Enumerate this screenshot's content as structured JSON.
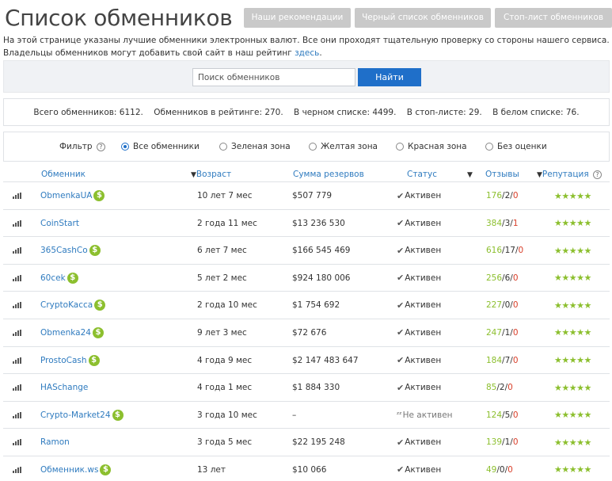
{
  "header": {
    "title": "Список обменников",
    "buttons": [
      "Наши рекомендации",
      "Черный список обменников",
      "Стоп-лист обменников"
    ]
  },
  "intro": {
    "line1": "На этой странице указаны лучшие обменники электронных валют. Все они проходят тщательную проверку со стороны нашего сервиса.",
    "line2": "Владельцы обменников могут добавить свой сайт в наш рейтинг ",
    "link": "здесь",
    "end": "."
  },
  "search": {
    "placeholder": "Поиск обменников",
    "button": "Найти"
  },
  "stats": {
    "total": "Всего обменников: 6112.",
    "rated": "Обменников в рейтинге: 270.",
    "black": "В черном списке: 4499.",
    "stop": "В стоп-листе: 29.",
    "white": "В белом списке: 76."
  },
  "filter": {
    "label": "Фильтр",
    "help": "?",
    "options": [
      "Все обменники",
      "Зеленая зона",
      "Желтая зона",
      "Красная зона",
      "Без оценки"
    ],
    "selected": "Все обменники"
  },
  "table": {
    "headers": {
      "name": "Обменник",
      "age": "Возраст",
      "reserve": "Сумма резервов",
      "status": "Статус",
      "reviews": "Отзывы",
      "reputation": "Репутация"
    },
    "rows": [
      {
        "name": "ObmenkaUA",
        "dollar": "$",
        "age": "10 лет 7 мес",
        "reserve": "$507 779",
        "status": "Активен",
        "active": true,
        "pos": "176",
        "neu": "2",
        "neg": "0",
        "stars": "★★★★★"
      },
      {
        "name": "CoinStart",
        "dollar": "",
        "age": "2 года 11 мес",
        "reserve": "$13 236 530",
        "status": "Активен",
        "active": true,
        "pos": "384",
        "neu": "3",
        "neg": "1",
        "stars": "★★★★★"
      },
      {
        "name": "365CashCo",
        "dollar": "$",
        "age": "6 лет 7 мес",
        "reserve": "$166 545 469",
        "status": "Активен",
        "active": true,
        "pos": "616",
        "neu": "17",
        "neg": "0",
        "stars": "★★★★★"
      },
      {
        "name": "60cek",
        "dollar": "$",
        "age": "5 лет 2 мес",
        "reserve": "$924 180 006",
        "status": "Активен",
        "active": true,
        "pos": "256",
        "neu": "6",
        "neg": "0",
        "stars": "★★★★★"
      },
      {
        "name": "CryptoKacca",
        "dollar": "$",
        "age": "2 года 10 мес",
        "reserve": "$1 754 692",
        "status": "Активен",
        "active": true,
        "pos": "227",
        "neu": "0",
        "neg": "0",
        "stars": "★★★★★"
      },
      {
        "name": "Obmenka24",
        "dollar": "$",
        "age": "9 лет 3 мес",
        "reserve": "$72 676",
        "status": "Активен",
        "active": true,
        "pos": "247",
        "neu": "1",
        "neg": "0",
        "stars": "★★★★★"
      },
      {
        "name": "ProstoCash",
        "dollar": "$",
        "age": "4 года 9 мес",
        "reserve": "$2 147 483 647",
        "status": "Активен",
        "active": true,
        "pos": "184",
        "neu": "7",
        "neg": "0",
        "stars": "★★★★★"
      },
      {
        "name": "HASchange",
        "dollar": "",
        "age": "4 года 1 мес",
        "reserve": "$1 884 330",
        "status": "Активен",
        "active": true,
        "pos": "85",
        "neu": "2",
        "neg": "0",
        "stars": "★★★★★"
      },
      {
        "name": "Crypto-Market24",
        "dollar": "$",
        "age": "3 года 10 мес",
        "reserve": "–",
        "status": "Не активен",
        "active": false,
        "pos": "124",
        "neu": "5",
        "neg": "0",
        "stars": "★★★★★"
      },
      {
        "name": "Ramon",
        "dollar": "",
        "age": "3 года 5 мес",
        "reserve": "$22 195 248",
        "status": "Активен",
        "active": true,
        "pos": "139",
        "neu": "1",
        "neg": "0",
        "stars": "★★★★★"
      },
      {
        "name": "Обменник.ws",
        "dollar": "$",
        "age": "13 лет",
        "reserve": "$10 066",
        "status": "Активен",
        "active": true,
        "pos": "49",
        "neu": "0",
        "neg": "0",
        "stars": "★★★★★"
      }
    ]
  },
  "colors": {
    "link": "#2f7bbf",
    "accent": "#1f6fc9",
    "positive": "#8cbf2e",
    "negative": "#d9402b"
  }
}
